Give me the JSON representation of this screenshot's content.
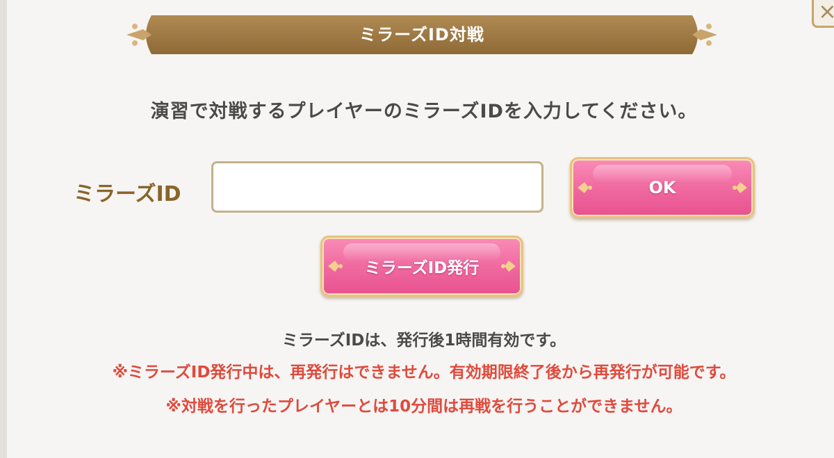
{
  "dialog": {
    "title": "ミラーズID対戦",
    "instruction": "演習で対戦するプレイヤーのミラーズIDを入力してください。",
    "close_icon": "close-icon"
  },
  "form": {
    "id_label": "ミラーズID",
    "id_value": "",
    "ok_label": "OK",
    "issue_label": "ミラーズID発行"
  },
  "notes": {
    "validity": "ミラーズIDは、発行後1時間有効です。",
    "warning_reissue": "※ミラーズID発行中は、再発行はできません。有効期限終了後から再発行が可能です。",
    "warning_rematch": "※対戦を行ったプレイヤーとは10分間は再戦を行うことができません。"
  },
  "colors": {
    "banner": "#a07a45",
    "button_pink": "#f06aa1",
    "button_border": "#e8c27d",
    "label_gold": "#8a6429",
    "warning_red": "#e04a3c",
    "text_dark": "#4a4a4a"
  }
}
